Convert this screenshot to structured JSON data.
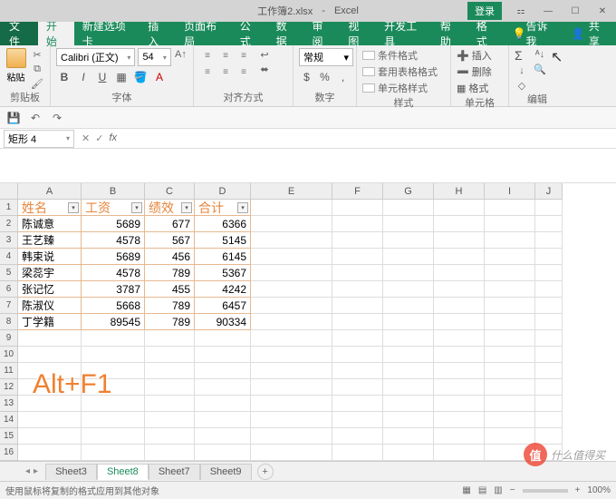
{
  "title": {
    "filename": "工作簿2.xlsx",
    "app": "Excel",
    "login": "登录"
  },
  "menu": {
    "file": "文件",
    "tabs": [
      "开始",
      "新建选项卡",
      "插入",
      "页面布局",
      "公式",
      "数据",
      "审阅",
      "视图",
      "开发工具",
      "帮助",
      "格式",
      "告诉我"
    ],
    "active_index": 0,
    "share": "共享"
  },
  "ribbon": {
    "clipboard": {
      "paste": "粘贴",
      "label": "剪贴板"
    },
    "font": {
      "name": "Calibri (正文)",
      "size": "54",
      "label": "字体"
    },
    "align": {
      "label": "对齐方式"
    },
    "number": {
      "format": "常规",
      "label": "数字"
    },
    "styles": {
      "cond": "条件格式",
      "table": "套用表格格式",
      "cell": "单元格样式",
      "label": "样式"
    },
    "cells": {
      "insert": "插入",
      "delete": "删除",
      "format": "格式",
      "label": "单元格"
    },
    "editing": {
      "label": "编辑"
    }
  },
  "namebox": "矩形 4",
  "columns": [
    "A",
    "B",
    "C",
    "D",
    "E",
    "F",
    "G",
    "H",
    "I",
    "J"
  ],
  "table": {
    "headers": [
      "姓名",
      "工资",
      "绩效",
      "合计"
    ],
    "rows": [
      {
        "name": "陈诚意",
        "salary": 5689,
        "perf": 677,
        "total": 6366
      },
      {
        "name": "王艺臻",
        "salary": 4578,
        "perf": 567,
        "total": 5145
      },
      {
        "name": "韩束说",
        "salary": 5689,
        "perf": 456,
        "total": 6145
      },
      {
        "name": "梁蕊宇",
        "salary": 4578,
        "perf": 789,
        "total": 5367
      },
      {
        "name": "张记忆",
        "salary": 3787,
        "perf": 455,
        "total": 4242
      },
      {
        "name": "陈淑仪",
        "salary": 5668,
        "perf": 789,
        "total": 6457
      },
      {
        "name": "丁学籍",
        "salary": 89545,
        "perf": 789,
        "total": 90334
      }
    ]
  },
  "chart_data": {
    "type": "table",
    "title": "",
    "columns": [
      "姓名",
      "工资",
      "绩效",
      "合计"
    ],
    "rows": [
      [
        "陈诚意",
        5689,
        677,
        6366
      ],
      [
        "王艺臻",
        4578,
        567,
        5145
      ],
      [
        "韩束说",
        5689,
        456,
        6145
      ],
      [
        "梁蕊宇",
        4578,
        789,
        5367
      ],
      [
        "张记忆",
        3787,
        455,
        4242
      ],
      [
        "陈淑仪",
        5668,
        789,
        6457
      ],
      [
        "丁学籍",
        89545,
        789,
        90334
      ]
    ]
  },
  "overlay": "Alt+F1",
  "sheets": {
    "items": [
      "Sheet3",
      "Sheet8",
      "Sheet7",
      "Sheet9"
    ],
    "active_index": 1
  },
  "status": {
    "left": "使用鼠标将复制的格式应用到其他对象",
    "zoom": "100%"
  },
  "watermark": {
    "char": "值",
    "text": "什么值得买"
  }
}
